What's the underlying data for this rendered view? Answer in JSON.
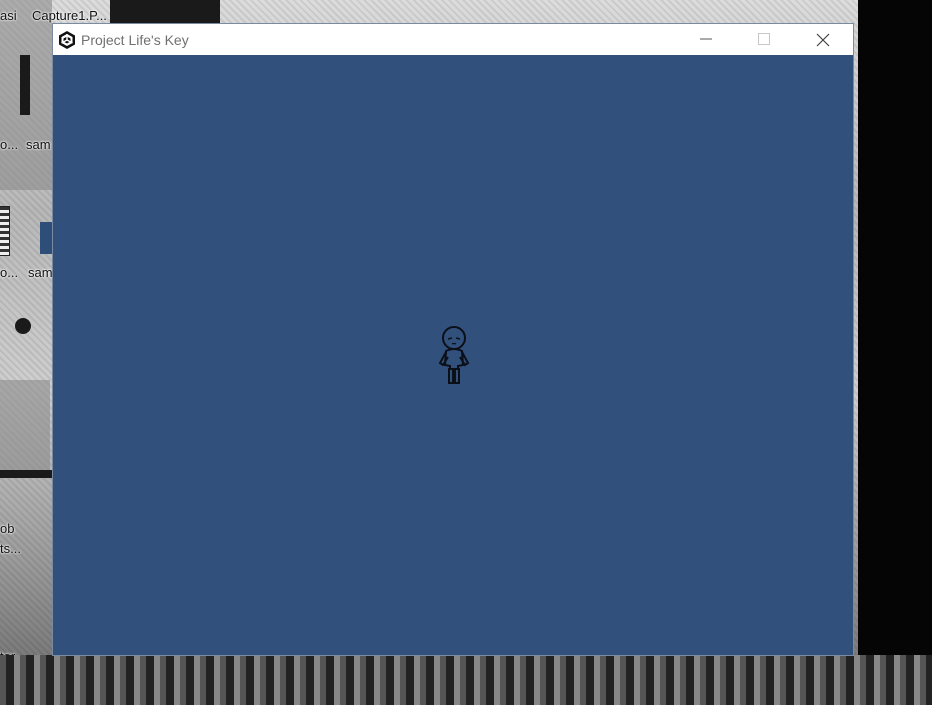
{
  "desktop": {
    "labels": [
      "asi",
      "Capture1.P...",
      "o...",
      "sam",
      "o...",
      "sam",
      "ob",
      "ts...",
      "tor"
    ]
  },
  "window": {
    "title": "Project Life's Key",
    "app_icon": "unity-icon",
    "controls": {
      "minimize": "minimize-icon",
      "maximize": "maximize-icon",
      "close": "close-icon"
    }
  },
  "game": {
    "background_color": "#32507c",
    "sprite": "chibi-character"
  }
}
